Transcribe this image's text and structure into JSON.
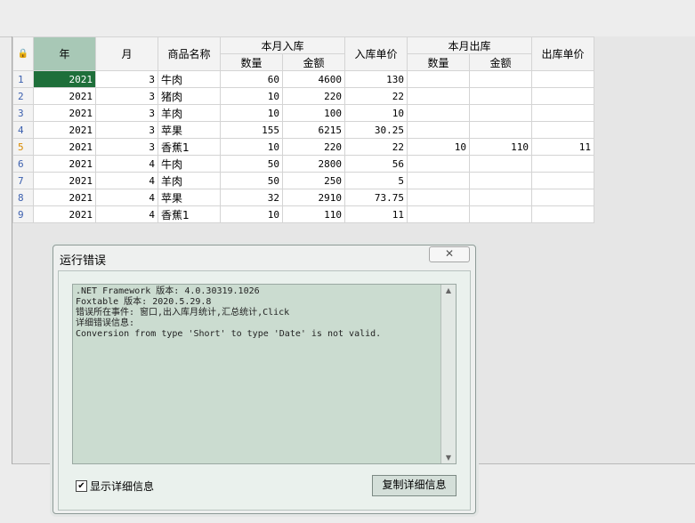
{
  "grid": {
    "lock_glyph": "🔒",
    "headers": {
      "year": "年",
      "month": "月",
      "product": "商品名称",
      "in_group": "本月入库",
      "in_qty": "数量",
      "in_amount": "金额",
      "in_price": "入库单价",
      "out_group": "本月出库",
      "out_qty": "数量",
      "out_amount": "金额",
      "out_price": "出库单价"
    },
    "rows": [
      {
        "n": "1",
        "year": "2021",
        "month": "3",
        "name": "牛肉",
        "in_qty": "60",
        "in_amount": "4600",
        "in_price": "130",
        "out_qty": "",
        "out_amount": "",
        "out_price": ""
      },
      {
        "n": "2",
        "year": "2021",
        "month": "3",
        "name": "猪肉",
        "in_qty": "10",
        "in_amount": "220",
        "in_price": "22",
        "out_qty": "",
        "out_amount": "",
        "out_price": ""
      },
      {
        "n": "3",
        "year": "2021",
        "month": "3",
        "name": "羊肉",
        "in_qty": "10",
        "in_amount": "100",
        "in_price": "10",
        "out_qty": "",
        "out_amount": "",
        "out_price": ""
      },
      {
        "n": "4",
        "year": "2021",
        "month": "3",
        "name": "苹果",
        "in_qty": "155",
        "in_amount": "6215",
        "in_price": "30.25",
        "out_qty": "",
        "out_amount": "",
        "out_price": ""
      },
      {
        "n": "5",
        "year": "2021",
        "month": "3",
        "name": "香蕉1",
        "in_qty": "10",
        "in_amount": "220",
        "in_price": "22",
        "out_qty": "10",
        "out_amount": "110",
        "out_price": "11"
      },
      {
        "n": "6",
        "year": "2021",
        "month": "4",
        "name": "牛肉",
        "in_qty": "50",
        "in_amount": "2800",
        "in_price": "56",
        "out_qty": "",
        "out_amount": "",
        "out_price": ""
      },
      {
        "n": "7",
        "year": "2021",
        "month": "4",
        "name": "羊肉",
        "in_qty": "50",
        "in_amount": "250",
        "in_price": "5",
        "out_qty": "",
        "out_amount": "",
        "out_price": ""
      },
      {
        "n": "8",
        "year": "2021",
        "month": "4",
        "name": "苹果",
        "in_qty": "32",
        "in_amount": "2910",
        "in_price": "73.75",
        "out_qty": "",
        "out_amount": "",
        "out_price": ""
      },
      {
        "n": "9",
        "year": "2021",
        "month": "4",
        "name": "香蕉1",
        "in_qty": "10",
        "in_amount": "110",
        "in_price": "11",
        "out_qty": "",
        "out_amount": "",
        "out_price": ""
      }
    ],
    "current_row": "5",
    "selected_row": "1"
  },
  "dialog": {
    "title": "运行错误",
    "close_glyph": "✕",
    "error_lines": [
      ".NET Framework 版本: 4.0.30319.1026",
      "Foxtable 版本: 2020.5.29.8",
      "错误所在事件: 窗口,出入库月统计,汇总统计,Click",
      "详细错误信息:",
      "Conversion from type 'Short' to type 'Date' is not valid."
    ],
    "show_details_label": "显示详细信息",
    "show_details_checked": true,
    "copy_button": "复制详细信息",
    "scroll_up": "▲",
    "scroll_down": "▼"
  }
}
